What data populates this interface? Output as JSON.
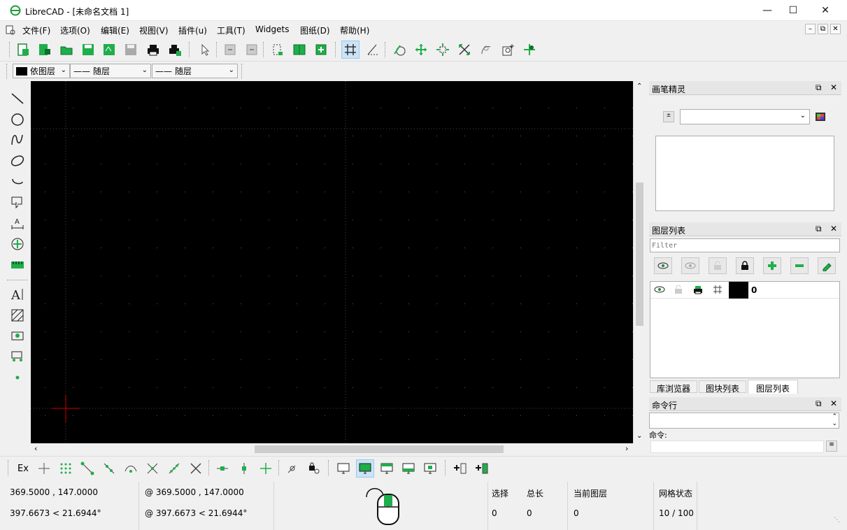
{
  "window": {
    "title": "LibreCAD - [未命名文档 1]"
  },
  "menu": [
    "文件(F)",
    "选项(O)",
    "编辑(E)",
    "视图(V)",
    "插件(u)",
    "工具(T)",
    "Widgets",
    "图纸(D)",
    "帮助(H)"
  ],
  "toolbar": {
    "icons": [
      "new-file-icon",
      "new-from-template-icon",
      "open-file-icon",
      "save-icon",
      "save-as-icon",
      "save-all-icon",
      "print-icon",
      "print-preview-icon",
      "select-pointer-icon",
      "undo-icon",
      "redo-icon",
      "block-icon",
      "split-view-icon",
      "add-view-icon",
      "grid-icon",
      "snap-distance-icon",
      "draft-mode-icon",
      "zoom-pan-icon",
      "zoom-window-icon",
      "zoom-auto-icon",
      "zoom-previous-icon",
      "zoom-in-icon",
      "zoom-redraw-icon"
    ]
  },
  "attributes": {
    "color": "依图层",
    "linetype": "随层",
    "linewidth": "随层"
  },
  "pen_wizard": {
    "title": "画笔精灵"
  },
  "layer_list": {
    "title": "图层列表",
    "filter_placeholder": "Filter",
    "layers": [
      {
        "name": "0",
        "color": "#000000"
      }
    ]
  },
  "tabs": [
    "库浏览器",
    "图块列表",
    "图层列表"
  ],
  "command_line": {
    "title": "命令行",
    "prompt": "命令:"
  },
  "status": {
    "abs_cart": "369.5000 , 147.0000",
    "abs_polar": "397.6673 < 21.6944°",
    "rel_cart": "@  369.5000 , 147.0000",
    "rel_polar": "@  397.6673 < 21.6944°",
    "selected_label": "选择",
    "selected_value": "0",
    "total_label": "总长",
    "total_value": "0",
    "layer_label": "当前图层",
    "layer_value": "0",
    "grid_label": "网格状态",
    "grid_value": "10 / 100"
  },
  "snap_toolbar": {
    "exclusive_label": "Ex"
  },
  "colors": {
    "canvas": "#000000",
    "accent": "#1fae4b",
    "crosshair": "#cc0000"
  }
}
